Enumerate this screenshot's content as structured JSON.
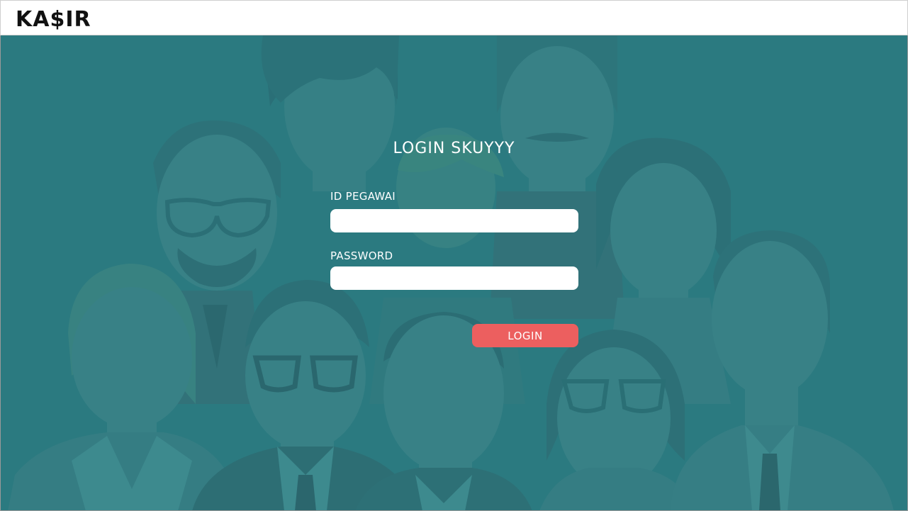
{
  "header": {
    "brand": "KA$IR"
  },
  "login": {
    "title": "LOGIN SKUYYY",
    "id_label": "ID PEGAWAI",
    "id_value": "",
    "password_label": "PASSWORD",
    "password_value": "",
    "button_label": "LOGIN"
  },
  "colors": {
    "background_teal": "#2b7b80",
    "button_red": "#ec5f5f",
    "text_white": "#ffffff",
    "brand_black": "#111111"
  }
}
